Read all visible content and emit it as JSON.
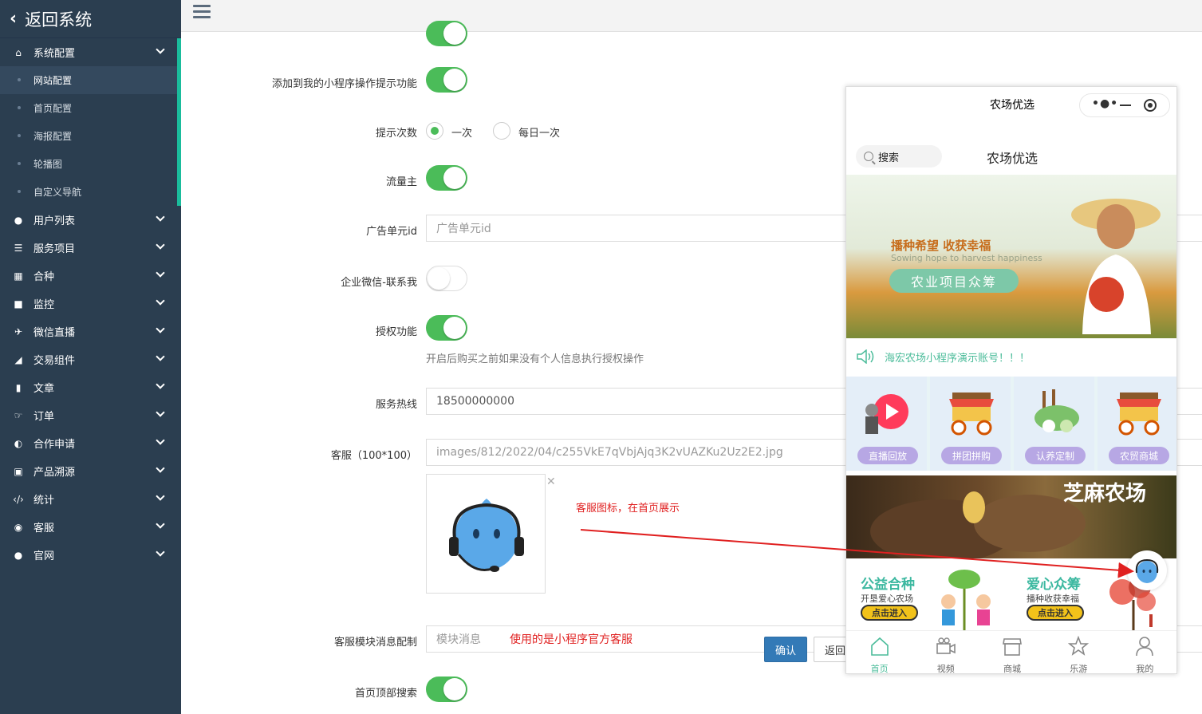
{
  "sidebar": {
    "back_label": "返回系统",
    "groups": [
      {
        "label": "系统配置",
        "icon": "home-icon",
        "expanded": true,
        "children": [
          "网站配置",
          "首页配置",
          "海报配置",
          "轮播图",
          "自定义导航"
        ]
      },
      {
        "label": "用户列表",
        "icon": "user-icon"
      },
      {
        "label": "服务项目",
        "icon": "list-icon"
      },
      {
        "label": "合种",
        "icon": "calendar-icon"
      },
      {
        "label": "监控",
        "icon": "video-icon"
      },
      {
        "label": "微信直播",
        "icon": "plane-icon"
      },
      {
        "label": "交易组件",
        "icon": "eraser-icon"
      },
      {
        "label": "文章",
        "icon": "book-icon"
      },
      {
        "label": "订单",
        "icon": "hand-icon"
      },
      {
        "label": "合作申请",
        "icon": "contrast-icon"
      },
      {
        "label": "产品溯源",
        "icon": "drive-icon"
      },
      {
        "label": "统计",
        "icon": "code-icon"
      },
      {
        "label": "客服",
        "icon": "wechat-icon"
      },
      {
        "label": "官网",
        "icon": "apple-icon"
      }
    ]
  },
  "form": {
    "add_tip_label": "添加到我的小程序操作提示功能",
    "tip_count_label": "提示次数",
    "tip_once": "一次",
    "tip_daily": "每日一次",
    "traffic_label": "流量主",
    "ad_unit_label": "广告单元id",
    "ad_unit_placeholder": "广告单元id",
    "wecom_label": "企业微信-联系我",
    "auth_label": "授权功能",
    "auth_help": "开启后购买之前如果没有个人信息执行授权操作",
    "hotline_label": "服务热线",
    "hotline_value": "18500000000",
    "cs_label": "客服（100*100）",
    "cs_value": "images/812/2022/04/c255VkE7qVbjAjq3K2vUAZKu2Uz2E2.jpg",
    "cs_note": "客服图标，在首页展示",
    "cs_msg_label": "客服模块消息配制",
    "cs_msg_placeholder": "模块消息",
    "cs_msg_note": "使用的是小程序官方客服",
    "home_search_label": "首页顶部搜索",
    "confirm_label": "确认",
    "back_label": "返回"
  },
  "phone": {
    "title": "农场优选",
    "search_label": "搜索",
    "store_name": "农场优选",
    "banner_slogan": "播种希望 收获幸福",
    "banner_slogan_en": "Sowing hope to harvest happiness",
    "banner_button": "农业项目众筹",
    "notice": "海宏农场小程序演示账号！！！",
    "categories": [
      "直播回放",
      "拼团拼购",
      "认养定制",
      "农贸商城"
    ],
    "hands_text": "芝麻农场",
    "card1_title": "公益合种",
    "card1_sub": "开垦爱心农场",
    "card1_btn": "点击进入",
    "card2_title": "爱心众筹",
    "card2_sub": "播种收获幸福",
    "card2_btn": "点击进入",
    "tabs": [
      "首页",
      "视频",
      "商城",
      "乐游",
      "我的"
    ]
  },
  "colors": {
    "sidebar_bg": "#2b3e50",
    "accent_green": "#4bbc59",
    "primary_blue": "#337ab7",
    "note_red": "#e02020",
    "teal": "#4bbc9a"
  }
}
